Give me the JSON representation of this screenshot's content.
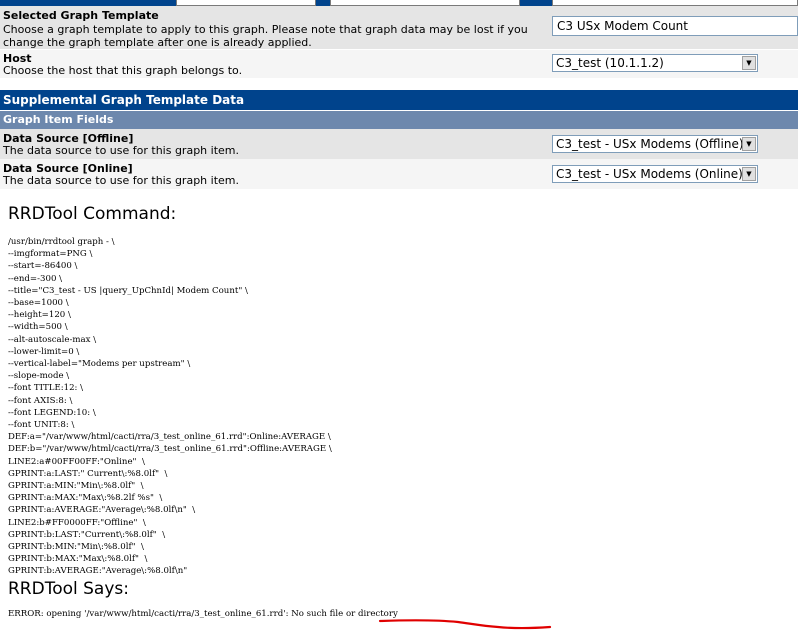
{
  "template": {
    "label": "Selected Graph Template",
    "desc": "Choose a graph template to apply to this graph. Please note that graph data may be lost if you change the graph template after one is already applied.",
    "value": "C3 USx Modem Count"
  },
  "host": {
    "label": "Host",
    "desc": "Choose the host that this graph belongs to.",
    "value": "C3_test (10.1.1.2)"
  },
  "supplemental": {
    "title": "Supplemental Graph Template Data",
    "subheader": "Graph Item Fields"
  },
  "ds_offline": {
    "label": "Data Source [Offline]",
    "desc": "The data source to use for this graph item.",
    "value": "C3_test - USx Modems (Offline)"
  },
  "ds_online": {
    "label": "Data Source [Online]",
    "desc": "The data source to use for this graph item.",
    "value": "C3_test - USx Modems (Online)"
  },
  "rrdtool": {
    "command_title": "RRDTool Command:",
    "command": "/usr/bin/rrdtool graph - \\\n--imgformat=PNG \\\n--start=-86400 \\\n--end=-300 \\\n--title=\"C3_test - US |query_UpChnId| Modem Count\" \\\n--base=1000 \\\n--height=120 \\\n--width=500 \\\n--alt-autoscale-max \\\n--lower-limit=0 \\\n--vertical-label=\"Modems per upstream\" \\\n--slope-mode \\\n--font TITLE:12: \\\n--font AXIS:8: \\\n--font LEGEND:10: \\\n--font UNIT:8: \\\nDEF:a=\"/var/www/html/cacti/rra/3_test_online_61.rrd\":Online:AVERAGE \\\nDEF:b=\"/var/www/html/cacti/rra/3_test_online_61.rrd\":Offline:AVERAGE \\\nLINE2:a#00FF00FF:\"Online\"  \\\nGPRINT:a:LAST:\" Current\\:%8.0lf\"  \\\nGPRINT:a:MIN:\"Min\\:%8.0lf\"  \\\nGPRINT:a:MAX:\"Max\\:%8.2lf %s\"  \\\nGPRINT:a:AVERAGE:\"Average\\:%8.0lf\\n\"  \\\nLINE2:b#FF0000FF:\"Offline\"  \\\nGPRINT:b:LAST:\"Current\\:%8.0lf\"  \\\nGPRINT:b:MIN:\"Min\\:%8.0lf\"  \\\nGPRINT:b:MAX:\"Max\\:%8.0lf\"  \\\nGPRINT:b:AVERAGE:\"Average\\:%8.0lf\\n\"",
    "says_title": "RRDTool Says:",
    "error_prefix": "ERROR: opening '/var/www/html/cacti/rra/3_test_online_61.rrd': ",
    "error_detail": "No such file or directory"
  },
  "colors": {
    "header_bg": "#00438c",
    "subheader_bg": "#6d88ad",
    "row_bg": "#e5e5e5",
    "annotation": "#e00000"
  }
}
